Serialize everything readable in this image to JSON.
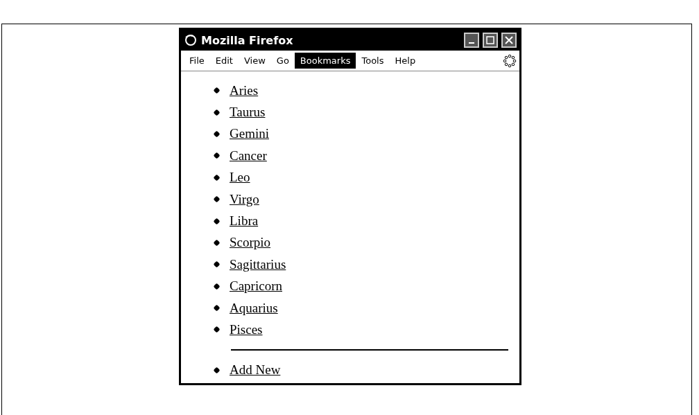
{
  "window": {
    "title": "Mozilla Firefox"
  },
  "menu_bar": {
    "items": [
      {
        "label": "File",
        "selected": false
      },
      {
        "label": "Edit",
        "selected": false
      },
      {
        "label": "View",
        "selected": false
      },
      {
        "label": "Go",
        "selected": false
      },
      {
        "label": "Bookmarks",
        "selected": true
      },
      {
        "label": "Tools",
        "selected": false
      },
      {
        "label": "Help",
        "selected": false
      }
    ]
  },
  "bookmarks": [
    {
      "label": "Aries"
    },
    {
      "label": "Taurus"
    },
    {
      "label": "Gemini"
    },
    {
      "label": "Cancer"
    },
    {
      "label": "Leo"
    },
    {
      "label": "Virgo"
    },
    {
      "label": "Libra"
    },
    {
      "label": "Scorpio"
    },
    {
      "label": "Sagittarius"
    },
    {
      "label": "Capricorn"
    },
    {
      "label": "Aquarius"
    },
    {
      "label": "Pisces"
    }
  ],
  "actions": [
    {
      "label": "Add New"
    }
  ]
}
